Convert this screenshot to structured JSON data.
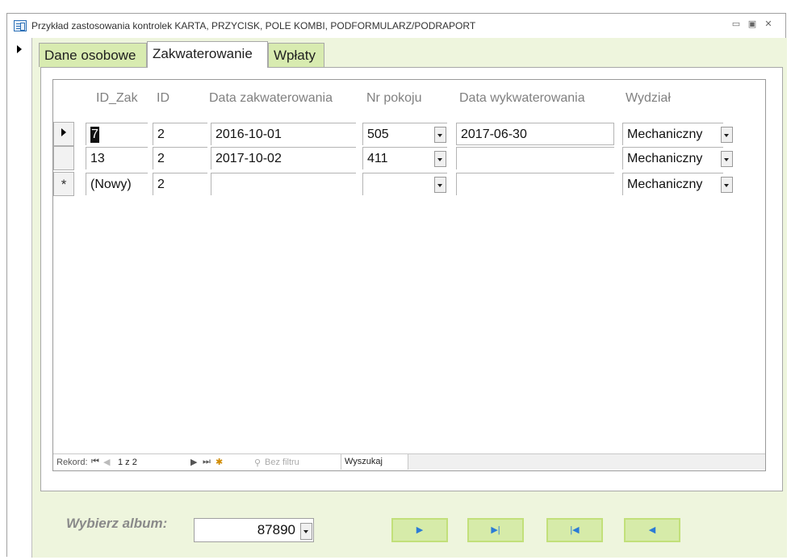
{
  "window": {
    "title": "Przykład zastosowania kontrolek KARTA, PRZYCISK, POLE KOMBI, PODFORMULARZ/PODRAPORT",
    "controls": [
      "minimize-icon",
      "restore-icon",
      "close-icon"
    ]
  },
  "tabs": [
    {
      "label": "Dane osobowe",
      "active": false
    },
    {
      "label": "Zakwaterowanie",
      "active": true
    },
    {
      "label": "Wpłaty",
      "active": false
    }
  ],
  "subform": {
    "columns": [
      "ID_Zak",
      "ID",
      "Data zakwaterowania",
      "Nr pokoju",
      "Data wykwaterowania",
      "Wydział"
    ],
    "rows": [
      {
        "id_zak": "7",
        "id": "2",
        "data_zak": "2016-10-01",
        "nr_pokoju": "505",
        "data_wyk": "2017-06-30",
        "wydzial": "Mechaniczny"
      },
      {
        "id_zak": "13",
        "id": "2",
        "data_zak": "2017-10-02",
        "nr_pokoju": "411",
        "data_wyk": "",
        "wydzial": "Mechaniczny"
      },
      {
        "id_zak": "(Nowy)",
        "id": "2",
        "data_zak": "",
        "nr_pokoju": "",
        "data_wyk": "",
        "wydzial": "Mechaniczny"
      }
    ],
    "new_row_marker": "*",
    "record_nav": {
      "label": "Rekord:",
      "position": "1 z 2",
      "filter": "Bez filtru",
      "search": "Wyszukaj"
    }
  },
  "album": {
    "label": "Wybierz album:",
    "value": "87890"
  },
  "nav_buttons": [
    {
      "name": "next-record-button",
      "glyph": "▶"
    },
    {
      "name": "last-record-button",
      "glyph": "▶|"
    },
    {
      "name": "first-record-button",
      "glyph": "|◀"
    },
    {
      "name": "previous-record-button",
      "glyph": "◀"
    }
  ],
  "colors": {
    "form_background": "#eef5dd",
    "tab_inactive": "#d8ebb0",
    "button_fill": "#d6eba9",
    "button_border": "#c2e07a",
    "nav_glyph": "#2b7bd6",
    "label_gray": "#8a8a8a"
  }
}
